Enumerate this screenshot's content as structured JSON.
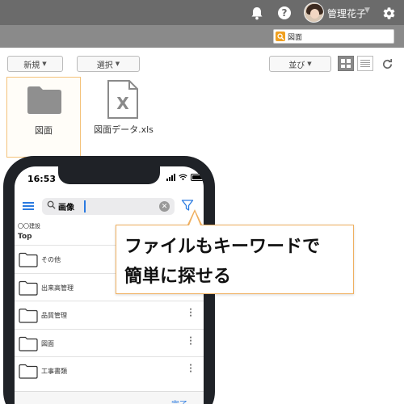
{
  "header": {
    "username": "管理花子",
    "icons": [
      "bell-icon",
      "help-icon",
      "avatar",
      "gear-icon"
    ]
  },
  "search": {
    "value": "図面",
    "icon": "search-icon"
  },
  "toolbar": {
    "new_label": "新規",
    "select_label": "選択",
    "sort_label": "並び",
    "view_icons": [
      "grid-view-icon",
      "list-view-icon",
      "refresh-icon"
    ]
  },
  "files": [
    {
      "name": "図面",
      "type": "folder"
    },
    {
      "name": "図面データ.xls",
      "type": "excel"
    }
  ],
  "phone": {
    "time": "16:53",
    "search_value": "画像",
    "breadcrumb": "〇〇建設",
    "top_label": "Top",
    "items": [
      {
        "label": "その他"
      },
      {
        "label": "出来高管理"
      },
      {
        "label": "品質管理"
      },
      {
        "label": "図面"
      },
      {
        "label": "工事書類"
      }
    ],
    "done_label": "完了"
  },
  "callout": {
    "line1": "ファイルもキーワードで",
    "line2": "簡単に探せる"
  },
  "colors": {
    "topbar": "#6b6b6b",
    "subbar": "#8a8a8a",
    "accent": "#f0a020",
    "ios_blue": "#2a7ae0",
    "callout_border": "#f0b060"
  }
}
